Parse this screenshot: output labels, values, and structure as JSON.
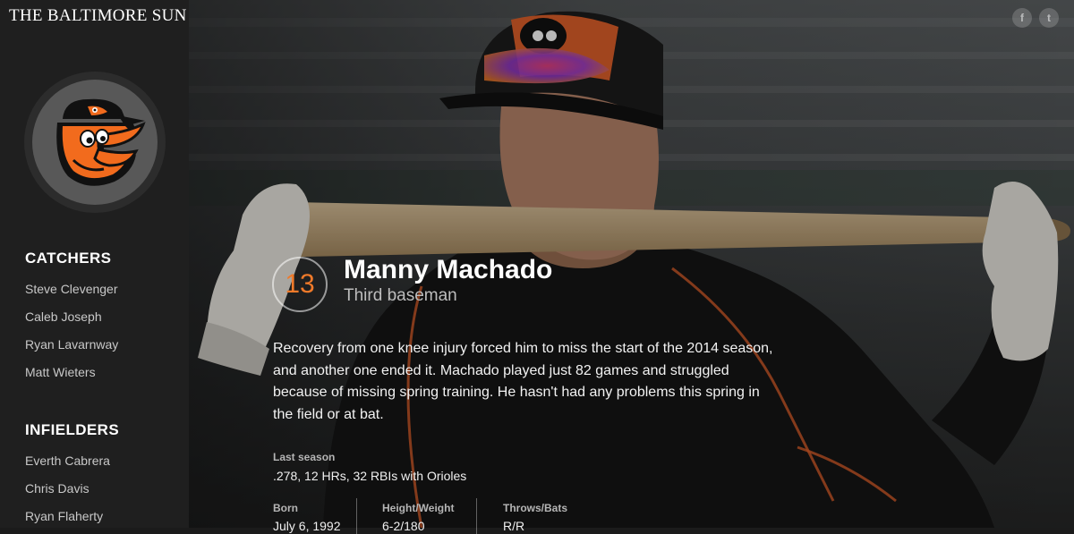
{
  "masthead": "THE BALTIMORE SUN",
  "logo": {
    "icon": "orioles-bird-logo",
    "colors": {
      "orange": "#f26b1d",
      "black": "#111111"
    }
  },
  "sidebar": {
    "sections": [
      {
        "title": "CATCHERS",
        "items": [
          "Steve Clevenger",
          "Caleb Joseph",
          "Ryan Lavarnway",
          "Matt Wieters"
        ]
      },
      {
        "title": "INFIELDERS",
        "items": [
          "Everth Cabrera",
          "Chris Davis",
          "Ryan Flaherty"
        ]
      }
    ]
  },
  "share": {
    "facebook_icon": "facebook-icon",
    "twitter_icon": "twitter-icon"
  },
  "player": {
    "number": "13",
    "name": "Manny Machado",
    "position": "Third baseman",
    "bio": "Recovery from one knee injury forced him to miss the start of the 2014 season, and another one ended it. Machado played just 82 games and struggled because of missing spring training. He hasn't had any problems this spring in the field or at bat.",
    "last_season_label": "Last season",
    "last_season_value": ".278, 12 HRs, 32 RBIs with Orioles",
    "born_label": "Born",
    "born_value": "July 6, 1992",
    "hw_label": "Height/Weight",
    "hw_value": "6-2/180",
    "tb_label": "Throws/Bats",
    "tb_value": "R/R"
  },
  "colors": {
    "accent": "#f07a2a",
    "sidebar_bg": "#1f1f1f"
  }
}
